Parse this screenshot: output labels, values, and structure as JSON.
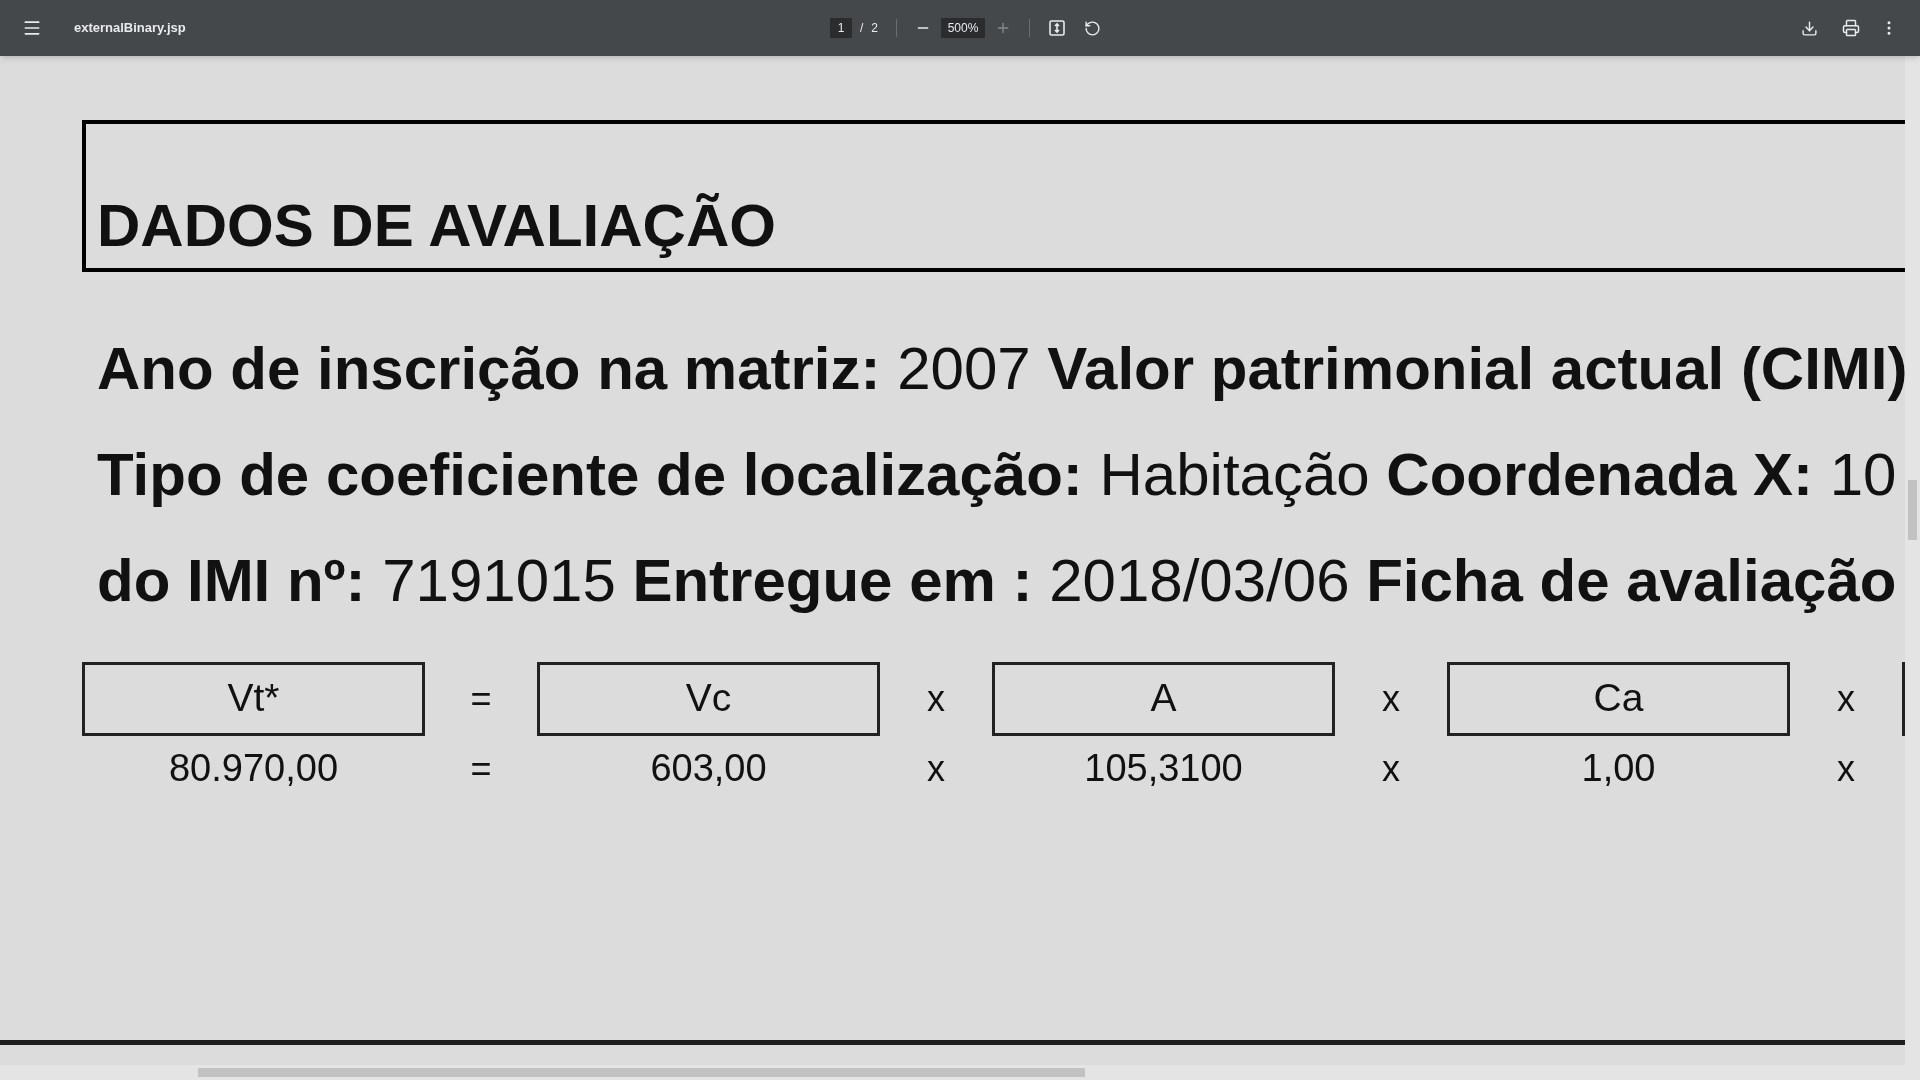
{
  "toolbar": {
    "title": "externalBinary.jsp",
    "page_current": "1",
    "page_separator": "/",
    "page_total": "2",
    "zoom": "500%",
    "zoom_in_disabled": true
  },
  "document": {
    "heading": "DADOS DE AVALIAÇÃO",
    "lines": [
      "**Ano de inscrição na matriz:** 2007 **Valor patrimonial actual (CIMI)**",
      "**Tipo de coeficiente de localização:** Habitação **Coordenada X:** 10",
      "**do IMI nº:** 7191015 **Entregue em :** 2018/03/06 **Ficha de avaliação**"
    ],
    "formula": [
      {
        "header": "Vt*",
        "value": "80.970,00",
        "operator_top": "=",
        "operator_bottom": "="
      },
      {
        "header": "Vc",
        "value": "603,00",
        "operator_top": "x",
        "operator_bottom": "x"
      },
      {
        "header": "A",
        "value": "105,3100",
        "operator_top": "x",
        "operator_bottom": "x"
      },
      {
        "header": "Ca",
        "value": "1,00",
        "operator_top": "x",
        "operator_bottom": "x"
      }
    ]
  }
}
